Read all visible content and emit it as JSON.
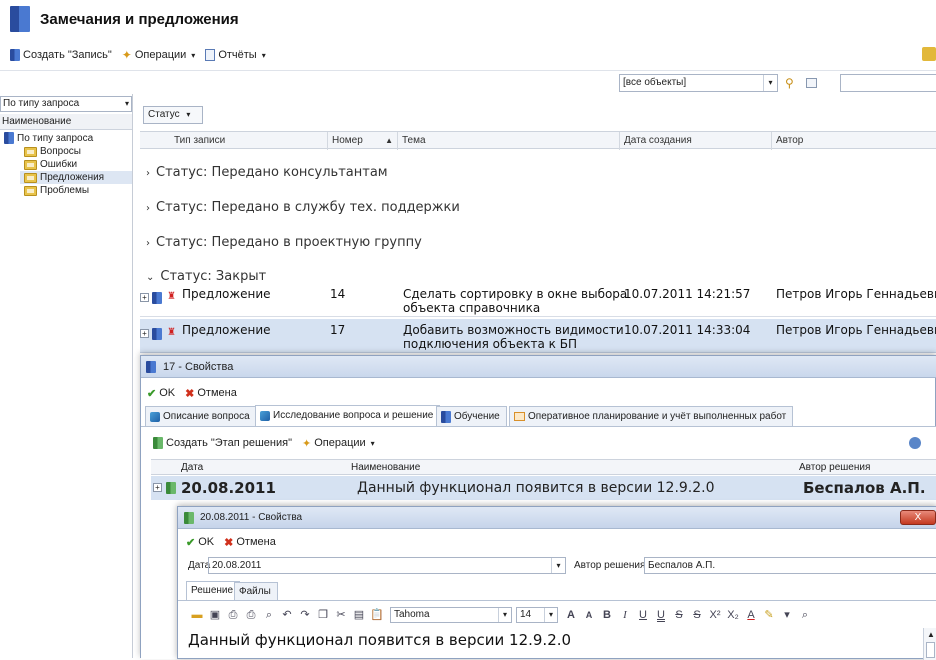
{
  "app": {
    "title": "Замечания и предложения"
  },
  "toolbar": {
    "create": "Создать \"Запись\"",
    "operations": "Операции",
    "reports": "Отчёты"
  },
  "filter": {
    "objects": "[все объекты]"
  },
  "left": {
    "combo": "По типу запроса",
    "header": "Наименование",
    "root": "По типу запроса",
    "items": [
      "Вопросы",
      "Ошибки",
      "Предложения",
      "Проблемы"
    ]
  },
  "grid": {
    "group_by": "Статус",
    "columns": [
      "Тип записи",
      "Номер",
      "Тема",
      "Дата создания",
      "Автор"
    ],
    "groups": [
      "Статус: Передано консультантам",
      "Статус: Передано в службу тех. поддержки",
      "Статус: Передано в проектную группу",
      "Статус: Закрыт"
    ],
    "rows": [
      {
        "type": "Предложение",
        "num": "14",
        "topic1": "Сделать сортировку в окне выбора",
        "topic2": "объекта справочника",
        "date": "10.07.2011 14:21:57",
        "author": "Петров Игорь Геннадьевич"
      },
      {
        "type": "Предложение",
        "num": "17",
        "topic1": "Добавить возможность видимости",
        "topic2": "подключения объекта к БП",
        "date": "10.07.2011 14:33:04",
        "author": "Петров Игорь Геннадьевич"
      }
    ]
  },
  "props": {
    "title": "17 - Свойства",
    "ok": "OK",
    "cancel": "Отмена",
    "tabs": [
      "Описание вопроса",
      "Исследование вопроса и решение",
      "Обучение",
      "Оперативное планирование и учёт выполненных работ"
    ],
    "create_step": "Создать \"Этап решения\"",
    "operations": "Операции",
    "columns": [
      "Дата",
      "Наименование",
      "Автор решения"
    ],
    "row": {
      "date": "20.08.2011",
      "name": "Данный функционал появится в версии 12.9.2.0",
      "author": "Беспалов А.П."
    }
  },
  "step": {
    "title": "20.08.2011 - Свойства",
    "ok": "OK",
    "cancel": "Отмена",
    "date_label": "Дата",
    "date_value": "20.08.2011",
    "author_label": "Автор решения",
    "author_value": "Беспалов А.П.",
    "tabs": [
      "Решение",
      "Файлы"
    ],
    "font": "Tahoma",
    "size": "14",
    "text": "Данный функционал появится в версии 12.9.2.0"
  }
}
